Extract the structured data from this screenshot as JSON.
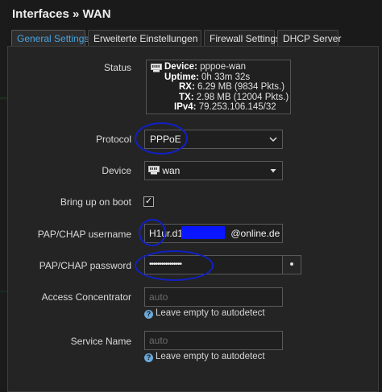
{
  "header": {
    "title": "Interfaces » WAN"
  },
  "tabs": [
    {
      "label": "General Settings"
    },
    {
      "label": "Erweiterte Einstellungen"
    },
    {
      "label": "Firewall Settings"
    },
    {
      "label": "DHCP Server"
    }
  ],
  "form": {
    "status_label": "Status",
    "status": {
      "device_key": "Device:",
      "device_val": "pppoe-wan",
      "uptime_key": "Uptime:",
      "uptime_val": "0h 33m 32s",
      "rx_key": "RX:",
      "rx_val": "6.29 MB (9834 Pkts.)",
      "tx_key": "TX:",
      "tx_val": "2.98 MB (12004 Pkts.)",
      "ipv4_key": "IPv4:",
      "ipv4_val": "79.253.106.145/32"
    },
    "protocol_label": "Protocol",
    "protocol_value": "PPPoE",
    "device_label": "Device",
    "device_value": "wan",
    "boot_label": "Bring up on boot",
    "boot_checked": "✓",
    "username_label": "PAP/CHAP username",
    "username_prefix": "H1ur.d1/",
    "username_suffix": "@online.de",
    "password_label": "PAP/CHAP password",
    "password_value": "••••••••••••••••",
    "access_label": "Access Concentrator",
    "access_placeholder": "auto",
    "access_hint": "Leave empty to autodetect",
    "service_label": "Service Name",
    "service_placeholder": "auto",
    "service_hint": "Leave empty to autodetect"
  },
  "colors": {
    "accent": "#4aa3df",
    "annotation": "#1020c8",
    "redaction": "#0a16ff"
  }
}
